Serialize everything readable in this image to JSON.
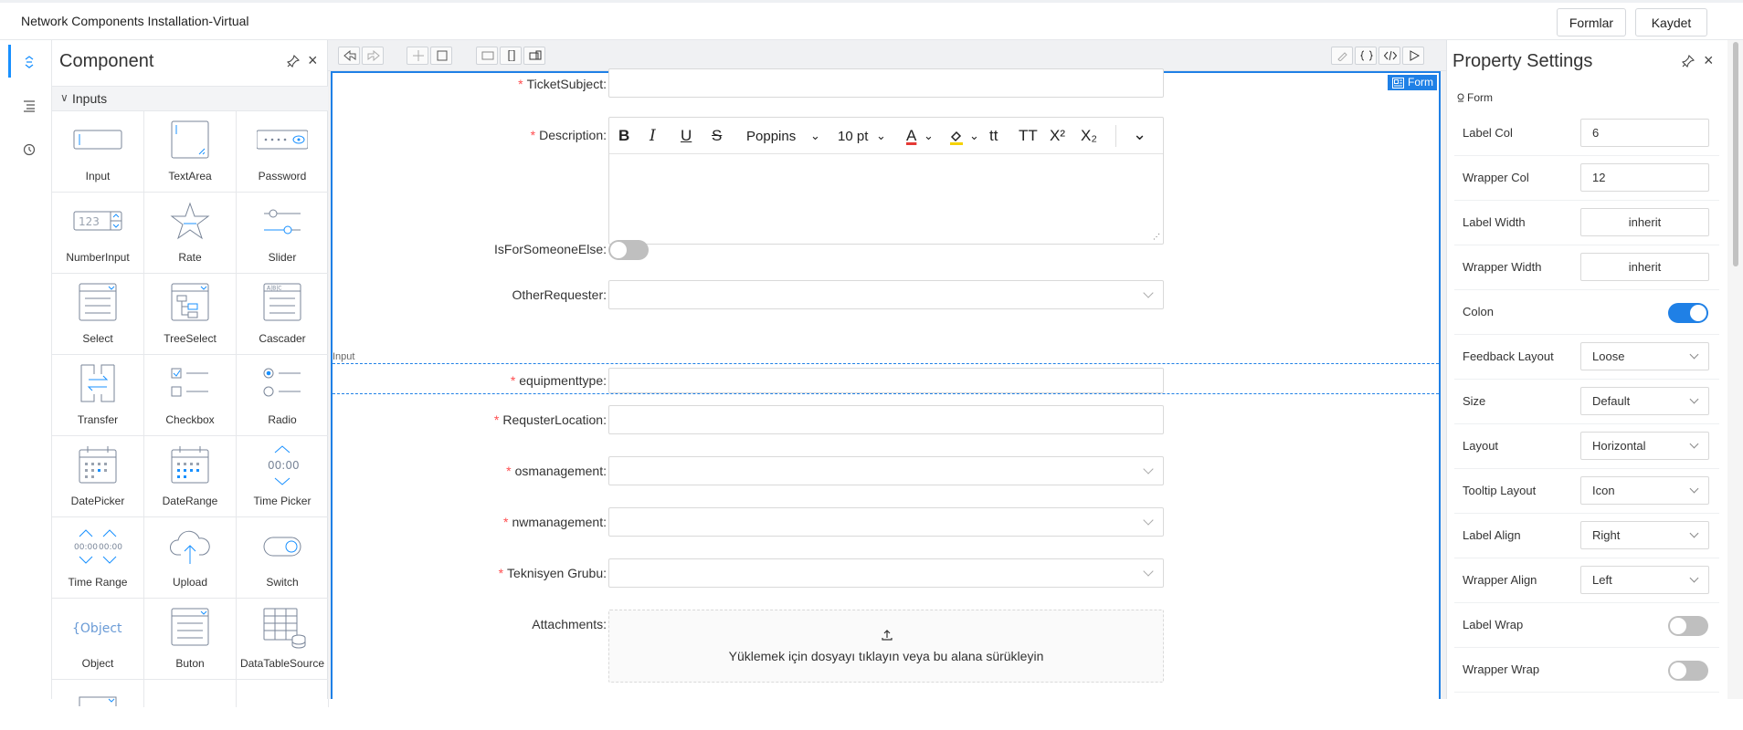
{
  "header": {
    "title": "Network Components Installation-Virtual",
    "formlar_label": "Formlar",
    "kaydet_label": "Kaydet"
  },
  "sidebar": {
    "icons": [
      "component-icon",
      "outline-icon",
      "history-icon"
    ]
  },
  "component_panel": {
    "title": "Component",
    "category": "Inputs",
    "items": [
      {
        "label": "Input",
        "icon": "input-icon"
      },
      {
        "label": "TextArea",
        "icon": "textarea-icon"
      },
      {
        "label": "Password",
        "icon": "password-icon"
      },
      {
        "label": "NumberInput",
        "icon": "number-input-icon"
      },
      {
        "label": "Rate",
        "icon": "star-icon"
      },
      {
        "label": "Slider",
        "icon": "slider-icon"
      },
      {
        "label": "Select",
        "icon": "select-icon"
      },
      {
        "label": "TreeSelect",
        "icon": "tree-select-icon"
      },
      {
        "label": "Cascader",
        "icon": "cascader-icon"
      },
      {
        "label": "Transfer",
        "icon": "transfer-icon"
      },
      {
        "label": "Checkbox",
        "icon": "checkbox-icon"
      },
      {
        "label": "Radio",
        "icon": "radio-icon"
      },
      {
        "label": "DatePicker",
        "icon": "calendar-icon"
      },
      {
        "label": "DateRange",
        "icon": "date-range-icon"
      },
      {
        "label": "Time Picker",
        "icon": "time-picker-icon"
      },
      {
        "label": "Time Range",
        "icon": "time-range-icon"
      },
      {
        "label": "Upload",
        "icon": "cloud-upload-icon"
      },
      {
        "label": "Switch",
        "icon": "switch-icon"
      },
      {
        "label": "Object",
        "icon": "object-icon"
      },
      {
        "label": "Buton",
        "icon": "button-icon"
      },
      {
        "label": "DataTableSource",
        "icon": "data-table-icon"
      }
    ],
    "glyphs": {
      "number": "123",
      "cascader": "A|B|C",
      "time": "00:00",
      "object": "{Object}"
    }
  },
  "canvas": {
    "form_tag": "Form",
    "selected_tag": "Input",
    "fields": {
      "ticket_subject": "TicketSubject:",
      "description": "Description:",
      "is_for_someone_else": "IsForSomeoneElse:",
      "other_requester": "OtherRequester:",
      "equipmenttype": "equipmenttype:",
      "requster_location": "RequsterLocation:",
      "osmanagement": "osmanagement:",
      "nwmanagement": "nwmanagement:",
      "teknisyen_grubu": "Teknisyen Grubu:",
      "attachments": "Attachments:"
    },
    "required_mark": "*",
    "editor": {
      "font": "Poppins",
      "size": "10 pt",
      "bold": "B",
      "italic": "I",
      "underline": "U",
      "strike": "S",
      "color": "A",
      "tt1": "tt",
      "tt2": "TT",
      "sup": "X²",
      "sub": "X₂"
    },
    "upload_text": "Yüklemek için dosyayı tıklayın veya bu alana sürükleyin"
  },
  "property_panel": {
    "title": "Property Settings",
    "crumb": "Form",
    "label_col": {
      "label": "Label Col",
      "value": "6"
    },
    "wrapper_col": {
      "label": "Wrapper Col",
      "value": "12"
    },
    "label_width": {
      "label": "Label Width",
      "value": "inherit"
    },
    "wrapper_width": {
      "label": "Wrapper Width",
      "value": "inherit"
    },
    "colon": {
      "label": "Colon",
      "on": true
    },
    "feedback_layout": {
      "label": "Feedback Layout",
      "value": "Loose"
    },
    "size": {
      "label": "Size",
      "value": "Default"
    },
    "layout": {
      "label": "Layout",
      "value": "Horizontal"
    },
    "tooltip_layout": {
      "label": "Tooltip Layout",
      "value": "Icon"
    },
    "label_align": {
      "label": "Label Align",
      "value": "Right"
    },
    "wrapper_align": {
      "label": "Wrapper Align",
      "value": "Left"
    },
    "label_wrap": {
      "label": "Label Wrap",
      "on": false
    },
    "wrapper_wrap": {
      "label": "Wrapper Wrap",
      "on": false
    }
  },
  "colors": {
    "accent": "#1f80e6",
    "required": "#ff4d4f"
  }
}
